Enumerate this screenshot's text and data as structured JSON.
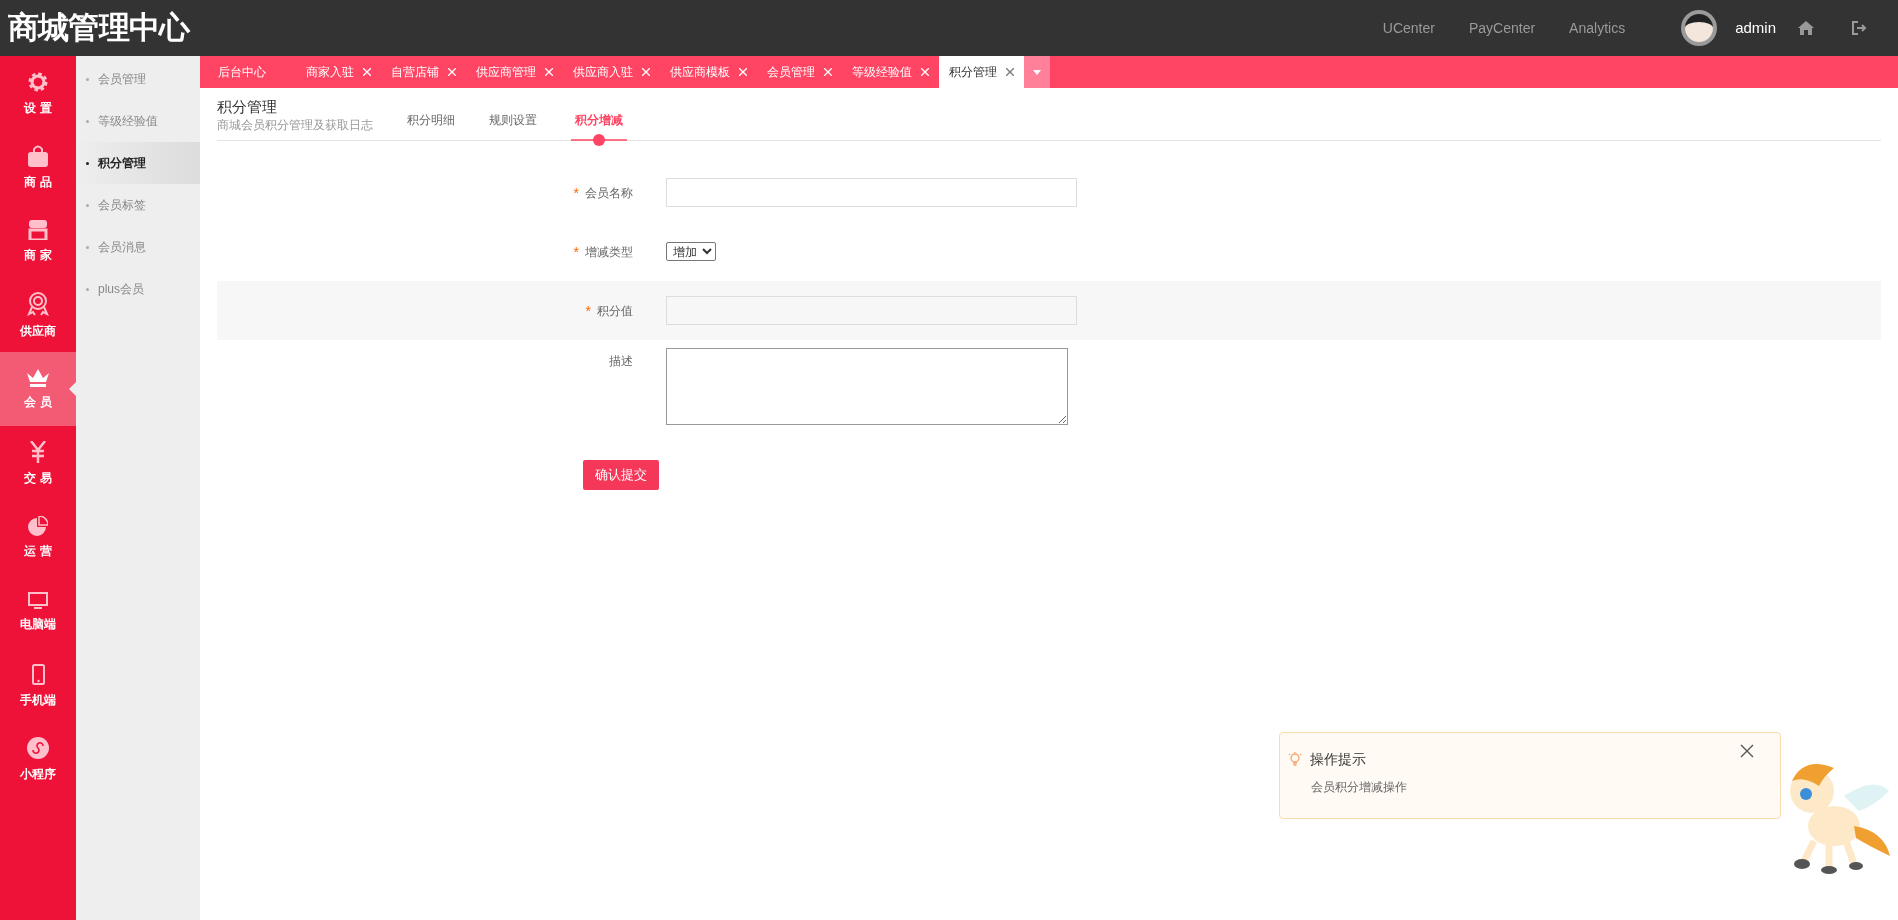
{
  "brand": "商城管理中心",
  "top_links": [
    "UCenter",
    "PayCenter",
    "Analytics"
  ],
  "user": {
    "name": "admin"
  },
  "rail": [
    {
      "label": "设 置",
      "selected": false
    },
    {
      "label": "商 品",
      "selected": false
    },
    {
      "label": "商 家",
      "selected": false
    },
    {
      "label": "供应商",
      "selected": false
    },
    {
      "label": "会 员",
      "selected": true
    },
    {
      "label": "交 易",
      "selected": false
    },
    {
      "label": "运 营",
      "selected": false
    },
    {
      "label": "电脑端",
      "selected": false
    },
    {
      "label": "手机端",
      "selected": false
    },
    {
      "label": "小程序",
      "selected": false
    }
  ],
  "subnav": [
    {
      "label": "会员管理",
      "selected": false
    },
    {
      "label": "等级经验值",
      "selected": false
    },
    {
      "label": "积分管理",
      "selected": true
    },
    {
      "label": "会员标签",
      "selected": false
    },
    {
      "label": "会员消息",
      "selected": false
    },
    {
      "label": "plus会员",
      "selected": false
    }
  ],
  "tabs": [
    {
      "label": "后台中心",
      "selected": false,
      "closable": false
    },
    {
      "label": "商家入驻",
      "selected": false,
      "closable": true
    },
    {
      "label": "自营店铺",
      "selected": false,
      "closable": true
    },
    {
      "label": "供应商管理",
      "selected": false,
      "closable": true
    },
    {
      "label": "供应商入驻",
      "selected": false,
      "closable": true
    },
    {
      "label": "供应商模板",
      "selected": false,
      "closable": true
    },
    {
      "label": "会员管理",
      "selected": false,
      "closable": true
    },
    {
      "label": "等级经验值",
      "selected": false,
      "closable": true
    },
    {
      "label": "积分管理",
      "selected": true,
      "closable": true
    }
  ],
  "page": {
    "title": "积分管理",
    "subtitle": "商城会员积分管理及获取日志"
  },
  "page_tabs": [
    {
      "label": "积分明细",
      "selected": false
    },
    {
      "label": "规则设置",
      "selected": false
    },
    {
      "label": "积分增减",
      "selected": true
    }
  ],
  "form": {
    "fields": [
      {
        "kind": "text",
        "label": "会员名称",
        "marker": "*",
        "highlighted": false
      },
      {
        "kind": "select",
        "label": "增减类型",
        "marker": "*",
        "highlighted": false,
        "value": "增加"
      },
      {
        "kind": "text",
        "label": "积分值",
        "marker": "*",
        "highlighted": true
      },
      {
        "kind": "textarea",
        "label": "描述",
        "highlighted": false
      }
    ],
    "submit": "确认提交"
  },
  "tip": {
    "title": "操作提示",
    "text": "会员积分增减操作"
  }
}
